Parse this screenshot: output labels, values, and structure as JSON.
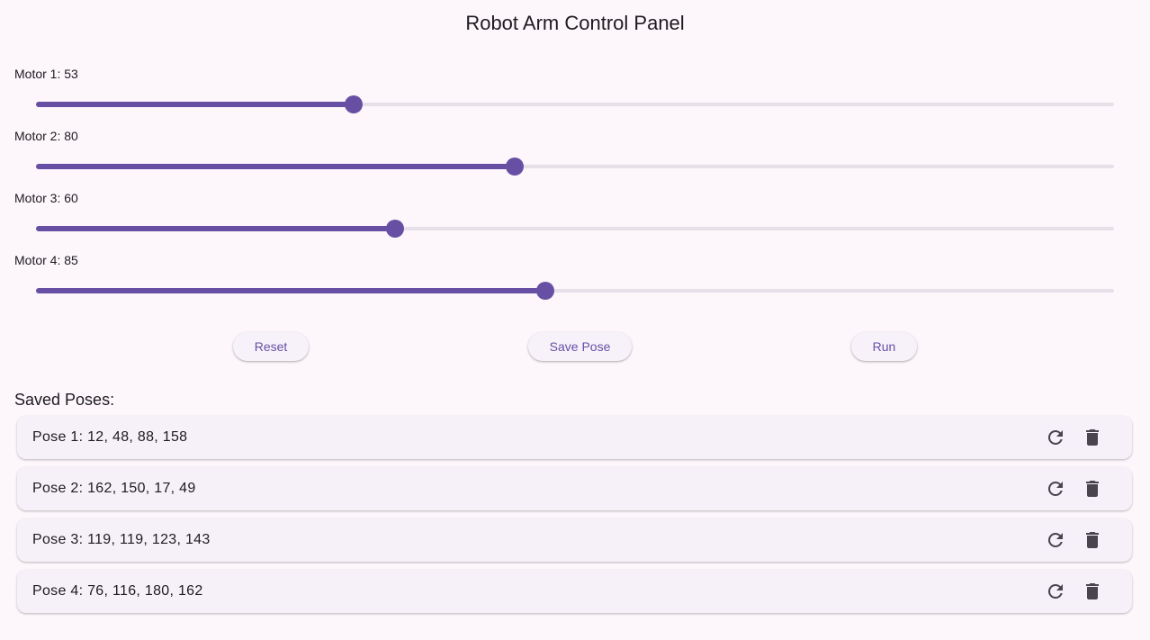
{
  "title": "Robot Arm Control Panel",
  "motors": [
    {
      "label": "Motor 1: 53",
      "value": 53,
      "max": 180
    },
    {
      "label": "Motor 2: 80",
      "value": 80,
      "max": 180
    },
    {
      "label": "Motor 3: 60",
      "value": 60,
      "max": 180
    },
    {
      "label": "Motor 4: 85",
      "value": 85,
      "max": 180
    }
  ],
  "buttons": {
    "reset": "Reset",
    "save_pose": "Save Pose",
    "run": "Run"
  },
  "saved_poses": {
    "heading": "Saved Poses:",
    "items": [
      {
        "text": "Pose 1: 12, 48, 88, 158"
      },
      {
        "text": "Pose 2: 162, 150, 17, 49"
      },
      {
        "text": "Pose 3: 119, 119, 123, 143"
      },
      {
        "text": "Pose 4: 76, 116, 180, 162"
      }
    ],
    "item_icons": [
      "refresh-icon",
      "delete-icon"
    ]
  },
  "colors": {
    "accent": "#6750a4",
    "track": "#e6e0e9",
    "background": "#fdf7fc",
    "card": "#f6f1f8"
  }
}
